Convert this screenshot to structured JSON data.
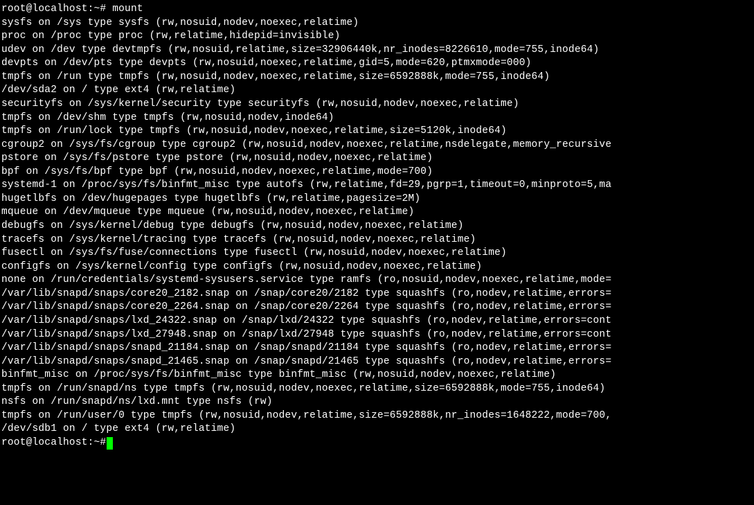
{
  "prompt1": "root@localhost:~# ",
  "command1": "mount",
  "lines": [
    "sysfs on /sys type sysfs (rw,nosuid,nodev,noexec,relatime)",
    "proc on /proc type proc (rw,relatime,hidepid=invisible)",
    "udev on /dev type devtmpfs (rw,nosuid,relatime,size=32906440k,nr_inodes=8226610,mode=755,inode64)",
    "devpts on /dev/pts type devpts (rw,nosuid,noexec,relatime,gid=5,mode=620,ptmxmode=000)",
    "tmpfs on /run type tmpfs (rw,nosuid,nodev,noexec,relatime,size=6592888k,mode=755,inode64)",
    "/dev/sda2 on / type ext4 (rw,relatime)",
    "securityfs on /sys/kernel/security type securityfs (rw,nosuid,nodev,noexec,relatime)",
    "tmpfs on /dev/shm type tmpfs (rw,nosuid,nodev,inode64)",
    "tmpfs on /run/lock type tmpfs (rw,nosuid,nodev,noexec,relatime,size=5120k,inode64)",
    "cgroup2 on /sys/fs/cgroup type cgroup2 (rw,nosuid,nodev,noexec,relatime,nsdelegate,memory_recursive",
    "pstore on /sys/fs/pstore type pstore (rw,nosuid,nodev,noexec,relatime)",
    "bpf on /sys/fs/bpf type bpf (rw,nosuid,nodev,noexec,relatime,mode=700)",
    "systemd-1 on /proc/sys/fs/binfmt_misc type autofs (rw,relatime,fd=29,pgrp=1,timeout=0,minproto=5,ma",
    "hugetlbfs on /dev/hugepages type hugetlbfs (rw,relatime,pagesize=2M)",
    "mqueue on /dev/mqueue type mqueue (rw,nosuid,nodev,noexec,relatime)",
    "debugfs on /sys/kernel/debug type debugfs (rw,nosuid,nodev,noexec,relatime)",
    "tracefs on /sys/kernel/tracing type tracefs (rw,nosuid,nodev,noexec,relatime)",
    "fusectl on /sys/fs/fuse/connections type fusectl (rw,nosuid,nodev,noexec,relatime)",
    "configfs on /sys/kernel/config type configfs (rw,nosuid,nodev,noexec,relatime)",
    "none on /run/credentials/systemd-sysusers.service type ramfs (ro,nosuid,nodev,noexec,relatime,mode=",
    "/var/lib/snapd/snaps/core20_2182.snap on /snap/core20/2182 type squashfs (ro,nodev,relatime,errors=",
    "/var/lib/snapd/snaps/core20_2264.snap on /snap/core20/2264 type squashfs (ro,nodev,relatime,errors=",
    "/var/lib/snapd/snaps/lxd_24322.snap on /snap/lxd/24322 type squashfs (ro,nodev,relatime,errors=cont",
    "/var/lib/snapd/snaps/lxd_27948.snap on /snap/lxd/27948 type squashfs (ro,nodev,relatime,errors=cont",
    "/var/lib/snapd/snaps/snapd_21184.snap on /snap/snapd/21184 type squashfs (ro,nodev,relatime,errors=",
    "/var/lib/snapd/snaps/snapd_21465.snap on /snap/snapd/21465 type squashfs (ro,nodev,relatime,errors=",
    "binfmt_misc on /proc/sys/fs/binfmt_misc type binfmt_misc (rw,nosuid,nodev,noexec,relatime)",
    "tmpfs on /run/snapd/ns type tmpfs (rw,nosuid,nodev,noexec,relatime,size=6592888k,mode=755,inode64)",
    "nsfs on /run/snapd/ns/lxd.mnt type nsfs (rw)",
    "tmpfs on /run/user/0 type tmpfs (rw,nosuid,nodev,relatime,size=6592888k,nr_inodes=1648222,mode=700,",
    "/dev/sdb1 on / type ext4 (rw,relatime)"
  ],
  "prompt2": "root@localhost:~# "
}
